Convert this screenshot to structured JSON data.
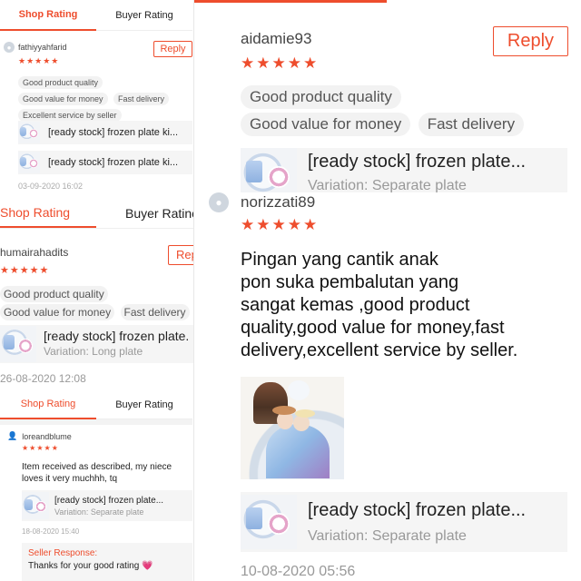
{
  "tabs": {
    "shop": "Shop Rating",
    "buyer": "Buyer Rating",
    "buyer_cut": "Buyer Ratinç"
  },
  "reply_label": "Reply",
  "reply_cut": "Rep",
  "stars": "★★★★★",
  "tags": {
    "quality": "Good product quality",
    "value": "Good value for money",
    "delivery": "Fast delivery",
    "service": "Excellent service by seller"
  },
  "product_name": "[ready stock] frozen plate ki...",
  "product_name_b": "[ready stock] frozen plate.",
  "product_name_c": "[ready stock] frozen plate...",
  "variation_long": "Variation: Long plate",
  "variation_separate": "Variation: Separate plate",
  "left_top": {
    "username": "fathiyyahfarid",
    "date": "03-09-2020 16:02"
  },
  "left_mid": {
    "username": "humairahadits",
    "date": "26-08-2020 12:08"
  },
  "left_bottom": {
    "username": "loreandblume",
    "comment_line1": "Item received as described, my niece",
    "comment_line2": "loves it very muchhh, tq",
    "date": "18-08-2020 15:40",
    "seller_response_label": "Seller Response:",
    "seller_response_text": "Thanks for your good rating 💗"
  },
  "right_top": {
    "username": "aidamie93"
  },
  "right_bottom": {
    "username": "norizzati89",
    "comment_line1": "Pingan yang cantik anak",
    "comment_line2": "pon suka pembalutan yang",
    "comment_line3": "sangat kemas ,good product",
    "comment_line4": "quality,good value for money,fast",
    "comment_line5": "delivery,excellent service by seller.",
    "date": "10-08-2020 05:56"
  },
  "colors": {
    "accent": "#ee4d2d",
    "muted": "#999999"
  }
}
